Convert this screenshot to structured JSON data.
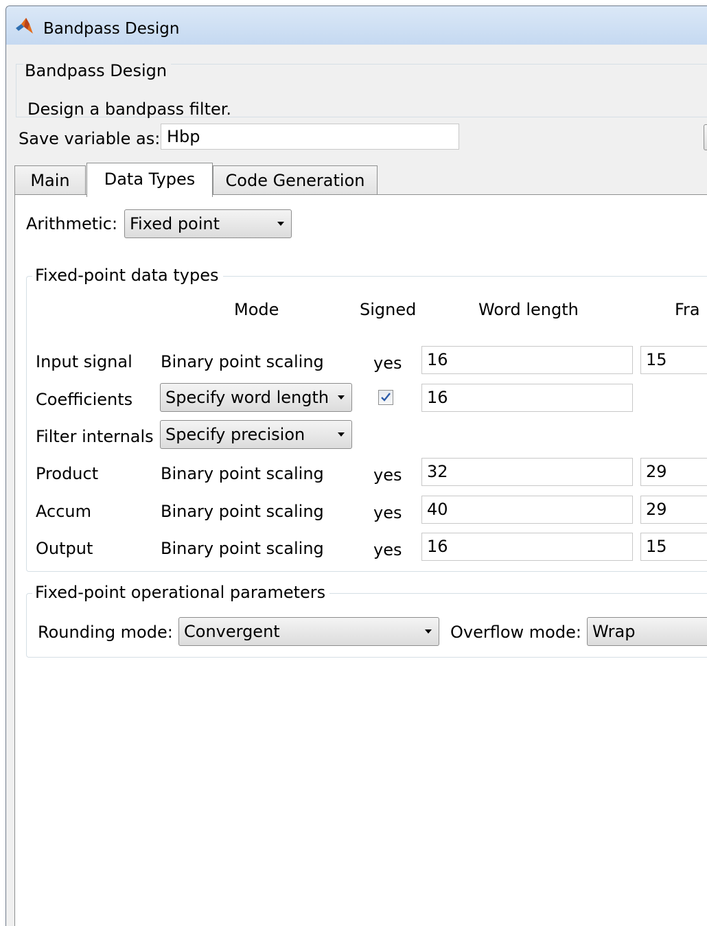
{
  "window": {
    "title": "Bandpass Design"
  },
  "header": {
    "title": "Bandpass Design",
    "description": "Design a bandpass filter."
  },
  "save": {
    "label": "Save variable as:",
    "value": "Hbp"
  },
  "tabs": [
    {
      "label": "Main",
      "active": false
    },
    {
      "label": "Data Types",
      "active": true
    },
    {
      "label": "Code Generation",
      "active": false
    }
  ],
  "arithmetic": {
    "label": "Arithmetic:",
    "value": "Fixed point"
  },
  "fixed_point": {
    "title": "Fixed-point data types",
    "columns": {
      "mode": "Mode",
      "signed": "Signed",
      "word_length": "Word length",
      "fraction_length": "Fra"
    },
    "rows": {
      "input": {
        "label": "Input signal",
        "mode": "Binary point scaling",
        "signed": "yes",
        "word_length": "16",
        "fraction_length": "15"
      },
      "coefficients": {
        "label": "Coefficients",
        "mode": "Specify word length",
        "signed_checked": true,
        "word_length": "16"
      },
      "internals": {
        "label": "Filter internals",
        "mode": "Specify precision"
      },
      "product": {
        "label": "Product",
        "mode": "Binary point scaling",
        "signed": "yes",
        "word_length": "32",
        "fraction_length": "29"
      },
      "accum": {
        "label": "Accum",
        "mode": "Binary point scaling",
        "signed": "yes",
        "word_length": "40",
        "fraction_length": "29"
      },
      "output": {
        "label": "Output",
        "mode": "Binary point scaling",
        "signed": "yes",
        "word_length": "16",
        "fraction_length": "15"
      }
    }
  },
  "operational": {
    "title": "Fixed-point operational parameters",
    "rounding_label": "Rounding mode:",
    "rounding_value": "Convergent",
    "overflow_label": "Overflow mode:",
    "overflow_value": "Wrap"
  },
  "icons": {
    "app": "matlab-logo-icon",
    "dropdown": "dropdown-arrow-icon",
    "check": "checkmark-icon"
  },
  "colors": {
    "titlebar": "#c5d9f1",
    "panel": "#f0f0f0",
    "check": "#2a5aa8"
  }
}
